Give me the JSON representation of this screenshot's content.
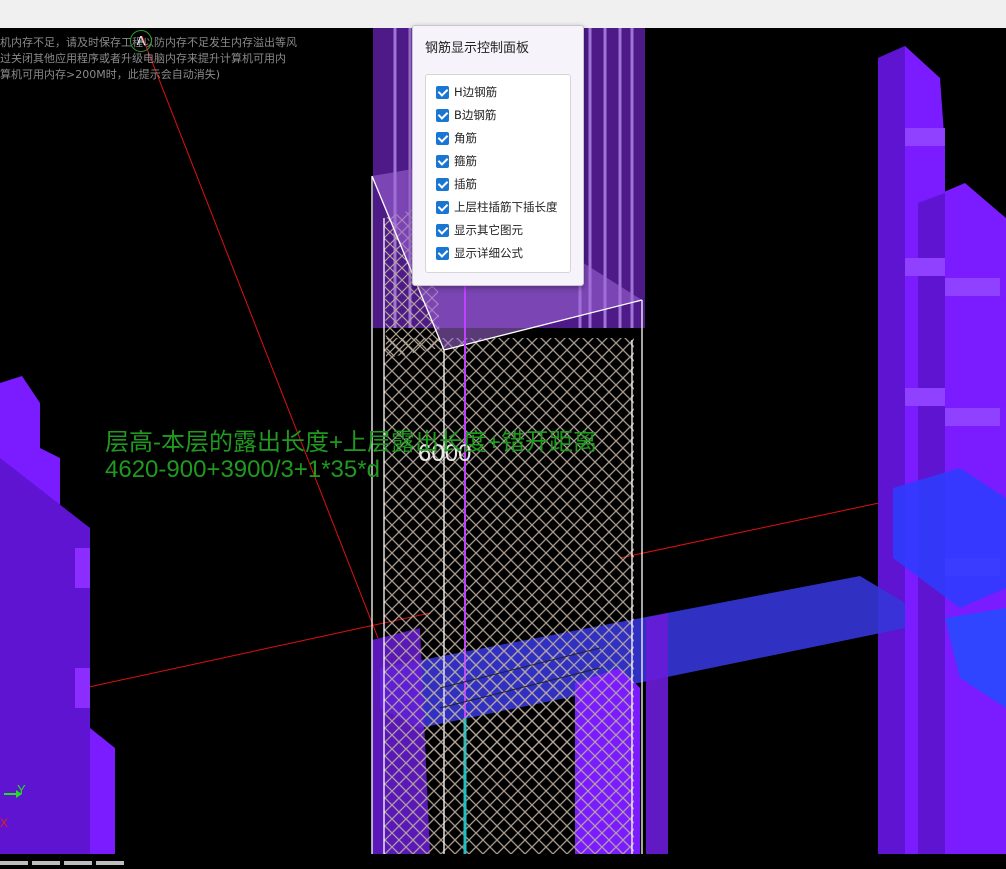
{
  "warning": {
    "lines": [
      "机内存不足，请及时保存工程以防内存不足发生内存溢出等风",
      "过关闭其他应用程序或者升级电脑内存来提升计算机可用内",
      "算机可用内存>200M时，此提示会自动消失)"
    ]
  },
  "axis": {
    "marker": "A",
    "y_label": "Y",
    "x_label": "X"
  },
  "annotation": {
    "formula_text": "层高-本层的露出长度+上层露出长度+错开距离",
    "formula_values": "4620-900+3900/3+1*35*d",
    "dimension": "6000"
  },
  "panel": {
    "title": "钢筋显示控制面板",
    "options": [
      {
        "label": "H边钢筋",
        "checked": true
      },
      {
        "label": "B边钢筋",
        "checked": true
      },
      {
        "label": "角筋",
        "checked": true
      },
      {
        "label": "箍筋",
        "checked": true
      },
      {
        "label": "插筋",
        "checked": true
      },
      {
        "label": "上层柱插筋下插长度",
        "checked": true
      },
      {
        "label": "显示其它图元",
        "checked": true
      },
      {
        "label": "显示详细公式",
        "checked": true
      }
    ]
  },
  "colors": {
    "column_purple": "#7a1cff",
    "column_dark": "#4a0fb0",
    "beam_blue": "#3a3ae0",
    "rebar": "#b9aa9c",
    "axis_line": "#e01010",
    "formula_green": "#1f9a1f",
    "checkbox": "#1976d2"
  }
}
